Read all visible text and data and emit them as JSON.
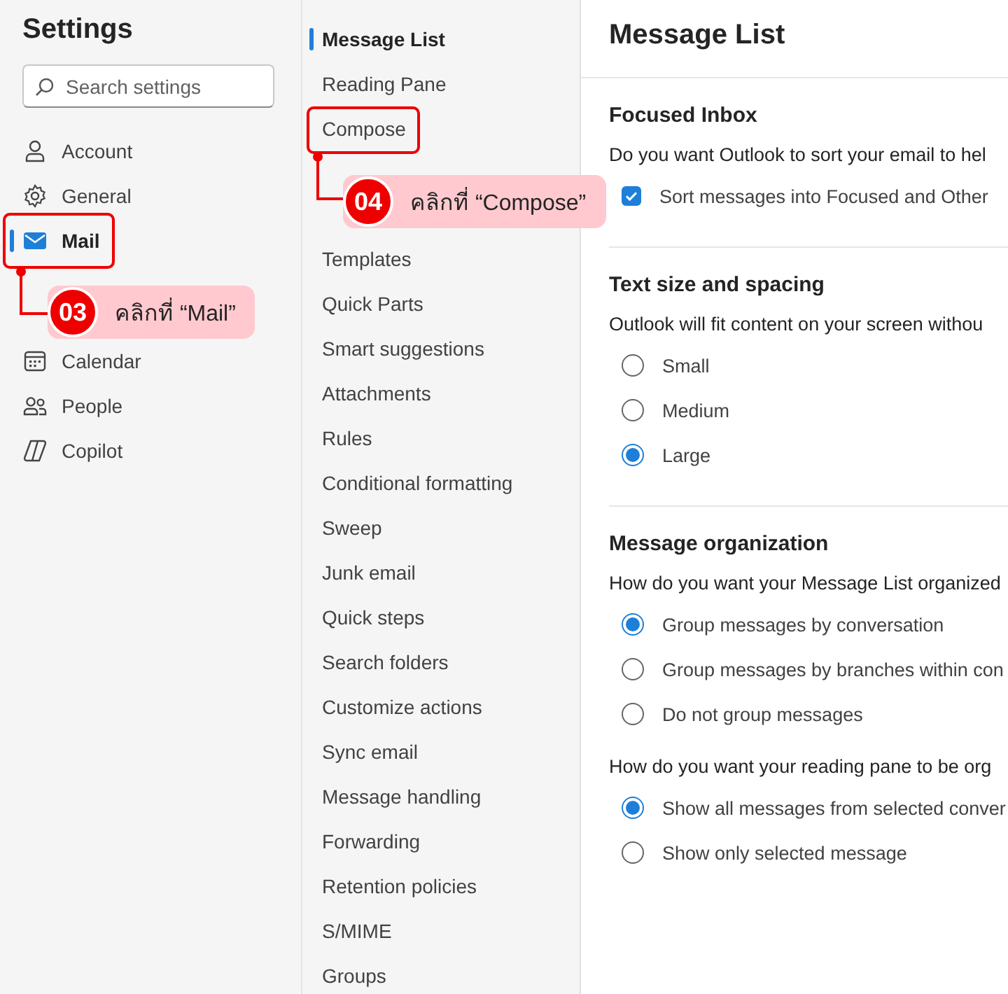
{
  "sidebar": {
    "title": "Settings",
    "search": {
      "placeholder": "Search settings"
    },
    "items": [
      {
        "label": "Account",
        "selected": false
      },
      {
        "label": "General",
        "selected": false
      },
      {
        "label": "Mail",
        "selected": true
      },
      {
        "label": "Calendar",
        "selected": false
      },
      {
        "label": "People",
        "selected": false
      },
      {
        "label": "Copilot",
        "selected": false
      }
    ]
  },
  "subnav": {
    "items": [
      {
        "label": "Message List",
        "selected": true
      },
      {
        "label": "Reading Pane",
        "selected": false
      },
      {
        "label": "Compose",
        "selected": false
      },
      {
        "label": "Templates",
        "selected": false
      },
      {
        "label": "Quick Parts",
        "selected": false
      },
      {
        "label": "Smart suggestions",
        "selected": false
      },
      {
        "label": "Attachments",
        "selected": false
      },
      {
        "label": "Rules",
        "selected": false
      },
      {
        "label": "Conditional formatting",
        "selected": false
      },
      {
        "label": "Sweep",
        "selected": false
      },
      {
        "label": "Junk email",
        "selected": false
      },
      {
        "label": "Quick steps",
        "selected": false
      },
      {
        "label": "Search folders",
        "selected": false
      },
      {
        "label": "Customize actions",
        "selected": false
      },
      {
        "label": "Sync email",
        "selected": false
      },
      {
        "label": "Message handling",
        "selected": false
      },
      {
        "label": "Forwarding",
        "selected": false
      },
      {
        "label": "Retention policies",
        "selected": false
      },
      {
        "label": "S/MIME",
        "selected": false
      },
      {
        "label": "Groups",
        "selected": false
      }
    ]
  },
  "content": {
    "title": "Message List",
    "sections": [
      {
        "heading": "Focused Inbox",
        "groups": [
          {
            "question": "Do you want Outlook to sort your email to hel",
            "options": [
              {
                "kind": "checkbox",
                "label": "Sort messages into Focused and Other",
                "checked": true
              }
            ]
          }
        ]
      },
      {
        "heading": "Text size and spacing",
        "groups": [
          {
            "question": "Outlook will fit content on your screen withou",
            "options": [
              {
                "kind": "radio",
                "label": "Small",
                "selected": false
              },
              {
                "kind": "radio",
                "label": "Medium",
                "selected": false
              },
              {
                "kind": "radio",
                "label": "Large",
                "selected": true
              }
            ]
          }
        ]
      },
      {
        "heading": "Message organization",
        "groups": [
          {
            "question": "How do you want your Message List organized",
            "options": [
              {
                "kind": "radio",
                "label": "Group messages by conversation",
                "selected": true
              },
              {
                "kind": "radio",
                "label": "Group messages by branches within con",
                "selected": false
              },
              {
                "kind": "radio",
                "label": "Do not group messages",
                "selected": false
              }
            ]
          },
          {
            "question": "How do you want your reading pane to be org",
            "options": [
              {
                "kind": "radio",
                "label": "Show all messages from selected conver",
                "selected": true
              },
              {
                "kind": "radio",
                "label": "Show only selected message",
                "selected": false
              }
            ]
          }
        ]
      }
    ]
  },
  "callouts": [
    {
      "number": "03",
      "text": "คลิกที่ “Mail”"
    },
    {
      "number": "04",
      "text": "คลิกที่ “Compose”"
    }
  ]
}
